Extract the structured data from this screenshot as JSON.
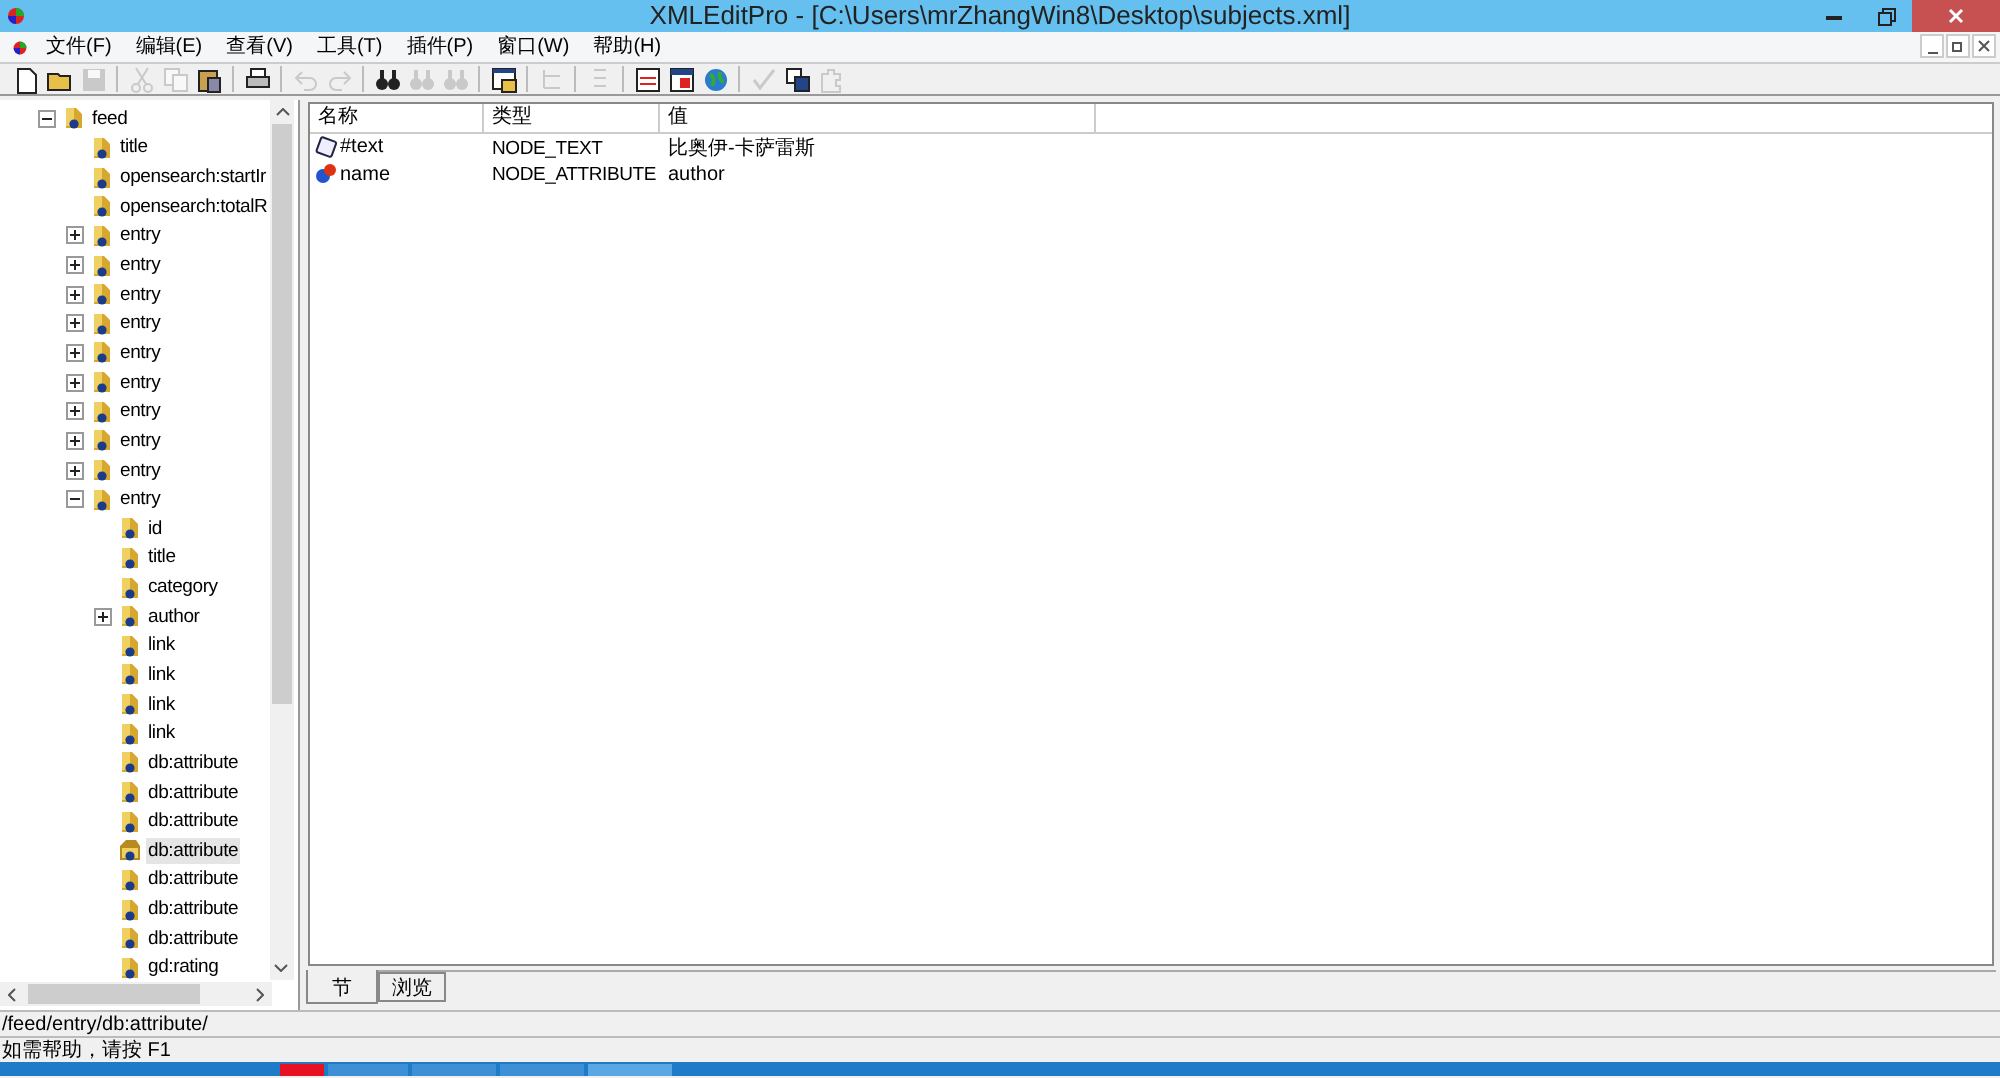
{
  "window": {
    "title": "XMLEditPro - [C:\\Users\\mrZhangWin8\\Desktop\\subjects.xml]"
  },
  "menu": [
    "文件(F)",
    "编辑(E)",
    "查看(V)",
    "工具(T)",
    "插件(P)",
    "窗口(W)",
    "帮助(H)"
  ],
  "toolbar": [
    {
      "kind": "new",
      "disabled": false
    },
    {
      "kind": "open",
      "disabled": false
    },
    {
      "kind": "save",
      "disabled": true
    },
    {
      "kind": "separator"
    },
    {
      "kind": "cut",
      "disabled": true
    },
    {
      "kind": "copy",
      "disabled": true
    },
    {
      "kind": "paste",
      "disabled": false
    },
    {
      "kind": "separator"
    },
    {
      "kind": "print",
      "disabled": false
    },
    {
      "kind": "separator"
    },
    {
      "kind": "undo",
      "disabled": true
    },
    {
      "kind": "redo",
      "disabled": true
    },
    {
      "kind": "separator"
    },
    {
      "kind": "find",
      "disabled": false
    },
    {
      "kind": "find",
      "disabled": true
    },
    {
      "kind": "find",
      "disabled": true
    },
    {
      "kind": "separator"
    },
    {
      "kind": "window",
      "disabled": false
    },
    {
      "kind": "separator"
    },
    {
      "kind": "tree",
      "disabled": true
    },
    {
      "kind": "separator"
    },
    {
      "kind": "list",
      "disabled": true
    },
    {
      "kind": "separator"
    },
    {
      "kind": "view",
      "disabled": false
    },
    {
      "kind": "grid",
      "disabled": false
    },
    {
      "kind": "globe",
      "disabled": false
    },
    {
      "kind": "separator"
    },
    {
      "kind": "check",
      "disabled": true
    },
    {
      "kind": "transform",
      "disabled": false
    },
    {
      "kind": "plugin",
      "disabled": true
    }
  ],
  "tree": [
    {
      "label": "feed",
      "expanded": true,
      "selected": false,
      "children": [
        {
          "label": "title",
          "selected": false
        },
        {
          "label": "opensearch:startIr",
          "selected": false
        },
        {
          "label": "opensearch:totalR",
          "selected": false
        },
        {
          "label": "entry",
          "expanded": false,
          "selected": false
        },
        {
          "label": "entry",
          "expanded": false,
          "selected": false
        },
        {
          "label": "entry",
          "expanded": false,
          "selected": false
        },
        {
          "label": "entry",
          "expanded": false,
          "selected": false
        },
        {
          "label": "entry",
          "expanded": false,
          "selected": false
        },
        {
          "label": "entry",
          "expanded": false,
          "selected": false
        },
        {
          "label": "entry",
          "expanded": false,
          "selected": false
        },
        {
          "label": "entry",
          "expanded": false,
          "selected": false
        },
        {
          "label": "entry",
          "expanded": false,
          "selected": false
        },
        {
          "label": "entry",
          "expanded": true,
          "selected": false,
          "children": [
            {
              "label": "id",
              "selected": false
            },
            {
              "label": "title",
              "selected": false
            },
            {
              "label": "category",
              "selected": false
            },
            {
              "label": "author",
              "expanded": false,
              "selected": false
            },
            {
              "label": "link",
              "selected": false
            },
            {
              "label": "link",
              "selected": false
            },
            {
              "label": "link",
              "selected": false
            },
            {
              "label": "link",
              "selected": false
            },
            {
              "label": "db:attribute",
              "selected": false
            },
            {
              "label": "db:attribute",
              "selected": false
            },
            {
              "label": "db:attribute",
              "selected": false
            },
            {
              "label": "db:attribute",
              "selected": true
            },
            {
              "label": "db:attribute",
              "selected": false
            },
            {
              "label": "db:attribute",
              "selected": false
            },
            {
              "label": "db:attribute",
              "selected": false
            },
            {
              "label": "gd:rating",
              "selected": false
            }
          ]
        }
      ]
    }
  ],
  "table": {
    "columns": [
      "名称",
      "类型",
      "值"
    ],
    "rows": [
      {
        "kind": "text",
        "name": "#text",
        "type": "NODE_TEXT",
        "value": "比奥伊-卡萨雷斯"
      },
      {
        "kind": "attribute",
        "name": "name",
        "type": "NODE_ATTRIBUTE",
        "value": "author"
      }
    ]
  },
  "tabs": [
    {
      "label": "节",
      "selected": true
    },
    {
      "label": "浏览",
      "selected": false
    }
  ],
  "path": "/feed/entry/db:attribute/",
  "status_bar": "如需帮助，请按 F1"
}
